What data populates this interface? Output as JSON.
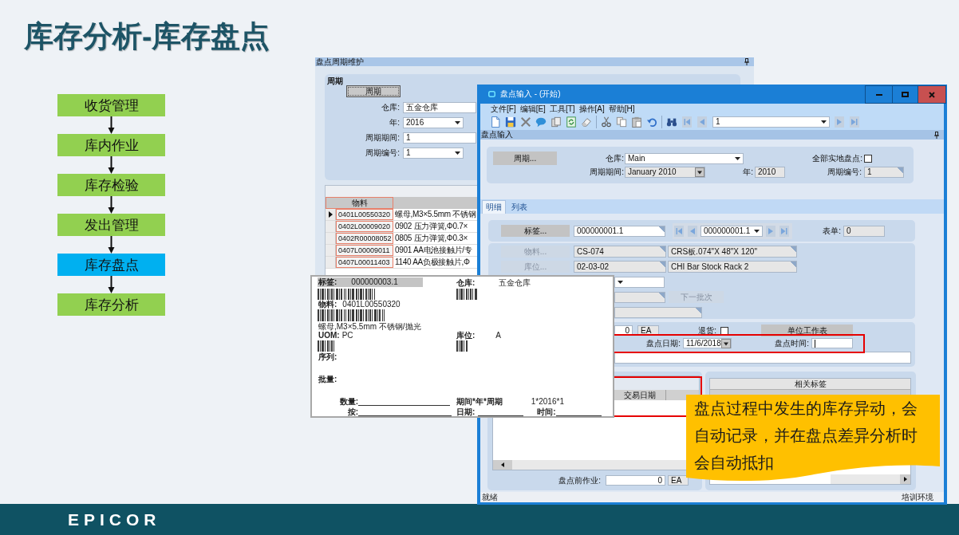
{
  "slide": {
    "title": "库存分析-库存盘点",
    "logo": "EPICOR"
  },
  "flow": [
    {
      "label": "收货管理",
      "selected": false
    },
    {
      "label": "库内作业",
      "selected": false
    },
    {
      "label": "库存检验",
      "selected": false
    },
    {
      "label": "发出管理",
      "selected": false
    },
    {
      "label": "库存盘点",
      "selected": true
    },
    {
      "label": "库存分析",
      "selected": false
    }
  ],
  "cycle_window": {
    "title": "盘点周期维护",
    "group_title": "周期",
    "cycle_button": "周期",
    "fields": [
      {
        "label": "仓库:",
        "value": "五金仓库",
        "kind": "text"
      },
      {
        "label": "年:",
        "value": "2016",
        "kind": "dropdown"
      },
      {
        "label": "周期期间:",
        "value": "1",
        "kind": "text"
      },
      {
        "label": "周期编号:",
        "value": "1",
        "kind": "dropdown"
      }
    ],
    "columns": [
      "物料"
    ],
    "rows": [
      {
        "selected": true,
        "part": "0401L00550320",
        "description": "螺母,M3×5.5mm 不锈钢"
      },
      {
        "selected": false,
        "part": "0402L00009020",
        "description": "0902 压力弹簧,Φ0.7×"
      },
      {
        "selected": false,
        "part": "0402R00008052",
        "description": "0805 压力弹簧,Φ0.3×"
      },
      {
        "selected": false,
        "part": "0407L00009011",
        "description": "0901 AA电池接触片/专"
      },
      {
        "selected": false,
        "part": "0407L00011403",
        "description": "1140 AA负极接触片,Φ"
      }
    ]
  },
  "entry_window": {
    "title": "盘点输入 - (开始)",
    "menu": [
      "文件[F]",
      "编辑[E]",
      "工具[T]",
      "操作[A]",
      "帮助[H]"
    ],
    "record": "1",
    "panel_title": "盘点输入",
    "cycle_button": {
      "label": "周期...",
      "disabled": false
    },
    "warehouse_label": "仓库:",
    "warehouse": "Main",
    "full_count_label": "全部实地盘点:",
    "full_count": {
      "checked": false
    },
    "period_label": "周期期间:",
    "period": "January 2010",
    "year_label": "年:",
    "year": "2010",
    "cycle_no_label": "周期编号:",
    "cycle_no": "1",
    "tabs": [
      {
        "label": "明细",
        "selected": true
      },
      {
        "label": "列表",
        "selected": false
      }
    ],
    "tag_button": {
      "label": "标签...",
      "disabled": false
    },
    "tag": "000000001.1",
    "tag_record": "000000001.1",
    "form_label": "表单:",
    "form": "0",
    "part_button": {
      "label": "物料...",
      "disabled": true
    },
    "part": "CS-074",
    "part_description": "CRS板.074\"X 48\"X 120\"",
    "bin_button": {
      "label": "库位...",
      "disabled": true
    },
    "bin": "02-03-02",
    "bin_description": "CHI Bar Stock Rack 2",
    "next_lot_button": {
      "label": "下一批次",
      "disabled": true
    },
    "quantity": "0",
    "quantity_uom": "EA",
    "return_label": "退货:",
    "return": {
      "checked": false
    },
    "uom_sheet_button": {
      "label": "单位工作表",
      "disabled": false
    },
    "count_date_label": "盘点日期:",
    "count_date": "11/6/2018",
    "count_time_label": "盘点时间:",
    "count_time": {
      "focused": true
    },
    "transactions": {
      "columns": [
        "交易日期"
      ]
    },
    "pre_count_label": "盘点前作业:",
    "pre_count": "0",
    "pre_count_uom": "EA",
    "related_tags": {
      "title": "相关标签"
    },
    "status": "就绪",
    "environment": "培训环境"
  },
  "tag_card": {
    "tag_label": "标签:",
    "tag": "000000003.1",
    "warehouse_label": "仓库:",
    "warehouse": "五金仓库",
    "part_label": "物料:",
    "part": "0401L00550320",
    "description": "螺母,M3×5.5mm 不锈钢/抛光",
    "uom_label": "UOM:",
    "uom": "PC",
    "bin_label": "库位:",
    "bin": "A",
    "serial_label": "序列:",
    "lot_label": "批量:",
    "qty_label": "数量:",
    "period_label": "期间*年*周期",
    "period": "1*2016*1",
    "by_label": "按:",
    "date_label": "日期:",
    "time_label": "时间:"
  },
  "callout": {
    "text": "盘点过程中发生的库存异动，会自动记录，并在盘点差异分析时会自动抵扣"
  }
}
